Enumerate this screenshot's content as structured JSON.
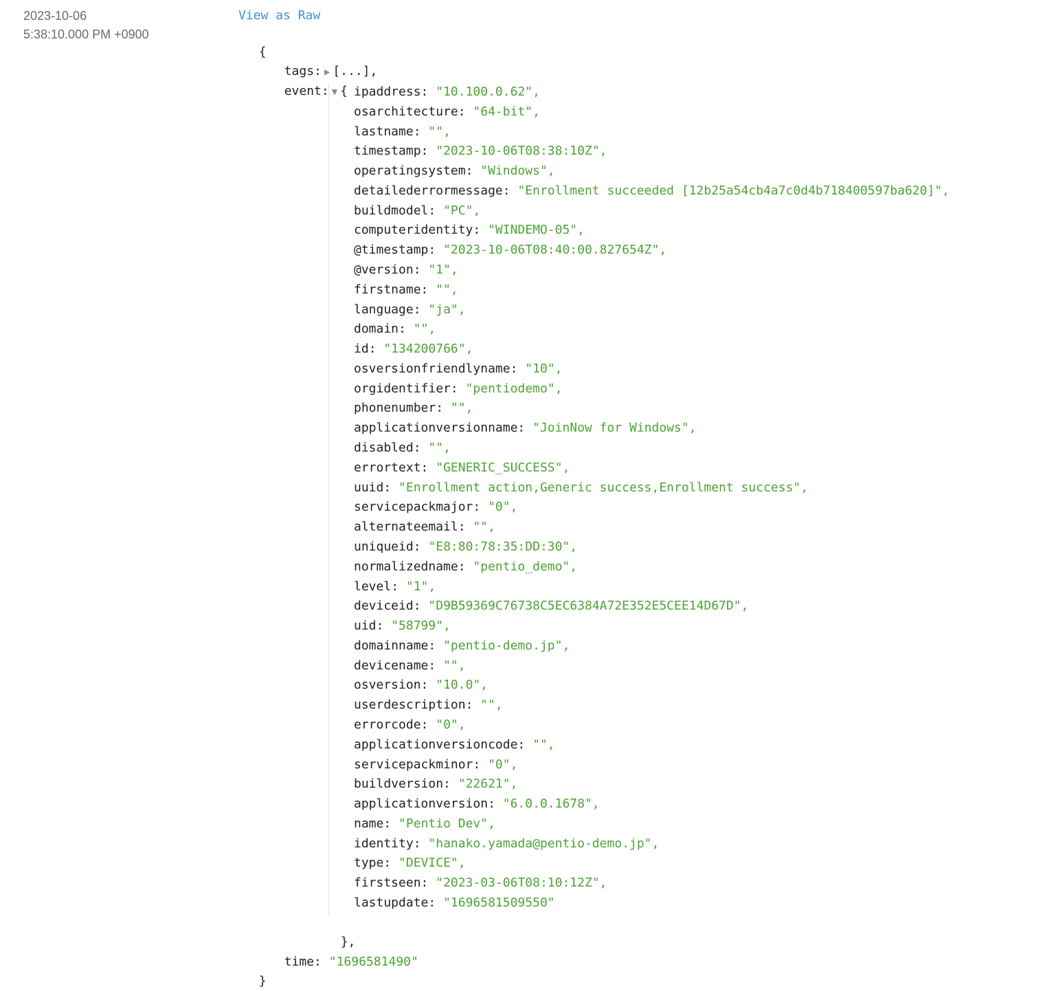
{
  "timestamp": {
    "date": "2023-10-06",
    "time": "5:38:10.000 PM +0900"
  },
  "view_raw_label": "View as Raw",
  "root": {
    "open_brace": "{",
    "close_brace": "}"
  },
  "tags": {
    "key": "tags",
    "collapsed_preview": "[...],",
    "toggle": "collapsed"
  },
  "event": {
    "key": "event",
    "toggle": "expanded",
    "open": "{",
    "close": "},",
    "fields": [
      {
        "key": "ipaddress",
        "value": "\"10.100.0.62\","
      },
      {
        "key": "osarchitecture",
        "value": "\"64-bit\","
      },
      {
        "key": "lastname",
        "value": "\"\","
      },
      {
        "key": "timestamp",
        "value": "\"2023-10-06T08:38:10Z\","
      },
      {
        "key": "operatingsystem",
        "value": "\"Windows\","
      },
      {
        "key": "detailederrormessage",
        "value": "\"Enrollment succeeded [12b25a54cb4a7c0d4b718400597ba620]\","
      },
      {
        "key": "buildmodel",
        "value": "\"PC\","
      },
      {
        "key": "computeridentity",
        "value": "\"WINDEMO-05\","
      },
      {
        "key": "@timestamp",
        "value": "\"2023-10-06T08:40:00.827654Z\","
      },
      {
        "key": "@version",
        "value": "\"1\","
      },
      {
        "key": "firstname",
        "value": "\"\","
      },
      {
        "key": "language",
        "value": "\"ja\","
      },
      {
        "key": "domain",
        "value": "\"\","
      },
      {
        "key": "id",
        "value": "\"134200766\","
      },
      {
        "key": "osversionfriendlyname",
        "value": "\"10\","
      },
      {
        "key": "orgidentifier",
        "value": "\"pentiodemo\","
      },
      {
        "key": "phonenumber",
        "value": "\"\","
      },
      {
        "key": "applicationversionname",
        "value": "\"JoinNow for Windows\","
      },
      {
        "key": "disabled",
        "value": "\"\","
      },
      {
        "key": "errortext",
        "value": "\"GENERIC_SUCCESS\","
      },
      {
        "key": "uuid",
        "value": "\"Enrollment action,Generic success,Enrollment success\","
      },
      {
        "key": "servicepackmajor",
        "value": "\"0\","
      },
      {
        "key": "alternateemail",
        "value": "\"\","
      },
      {
        "key": "uniqueid",
        "value": "\"E8:80:78:35:DD:30\","
      },
      {
        "key": "normalizedname",
        "value": "\"pentio_demo\","
      },
      {
        "key": "level",
        "value": "\"1\","
      },
      {
        "key": "deviceid",
        "value": "\"D9B59369C76738C5EC6384A72E352E5CEE14D67D\","
      },
      {
        "key": "uid",
        "value": "\"58799\","
      },
      {
        "key": "domainname",
        "value": "\"pentio-demo.jp\","
      },
      {
        "key": "devicename",
        "value": "\"\","
      },
      {
        "key": "osversion",
        "value": "\"10.0\","
      },
      {
        "key": "userdescription",
        "value": "\"\","
      },
      {
        "key": "errorcode",
        "value": "\"0\","
      },
      {
        "key": "applicationversioncode",
        "value": "\"\","
      },
      {
        "key": "servicepackminor",
        "value": "\"0\","
      },
      {
        "key": "buildversion",
        "value": "\"22621\","
      },
      {
        "key": "applicationversion",
        "value": "\"6.0.0.1678\","
      },
      {
        "key": "name",
        "value": "\"Pentio Dev\","
      },
      {
        "key": "identity",
        "value": "\"hanako.yamada@pentio-demo.jp\","
      },
      {
        "key": "type",
        "value": "\"DEVICE\","
      },
      {
        "key": "firstseen",
        "value": "\"2023-03-06T08:10:12Z\","
      },
      {
        "key": "lastupdate",
        "value": "\"1696581509550\""
      }
    ]
  },
  "time": {
    "key": "time",
    "value": "\"1696581490\""
  },
  "colors": {
    "string": "#4ca335",
    "key": "#222222",
    "link": "#3c94d6",
    "timestamp": "#6b6b6b",
    "toggle": "#8a8a8a"
  },
  "icons": {
    "collapsed": "triangle-right-icon",
    "expanded": "triangle-down-icon"
  }
}
